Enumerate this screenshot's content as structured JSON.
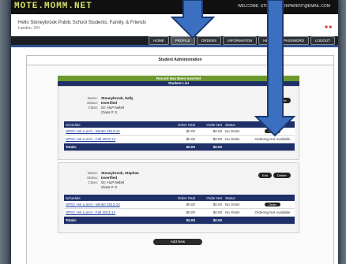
{
  "header": {
    "logo": "MOTE.MOMM.NET",
    "welcome": "WELCOME: STONEBROOKPARENT@EMAIL.COM",
    "greeting": "Hello Stoneybrook Public School Students, Family, & Friends",
    "location": "Landon, OH",
    "flags": "■ ■"
  },
  "nav": {
    "tabs": [
      "HOME",
      "PROFILE",
      "ORDERS",
      "INFORMATION",
      "HELP",
      "PASSWORD",
      "LOGOUT"
    ]
  },
  "panel": {
    "title": "Student Administration"
  },
  "list": {
    "banner": "Record Has Been Inserted",
    "subtitle": "Student List"
  },
  "labels": {
    "name": "Name:",
    "status": "Status:",
    "class": "Class:"
  },
  "students": [
    {
      "name": "Stoneybrook, Sally",
      "status": "Inverified",
      "class_line1": "Gr: HLP Nebel",
      "class_line2": "Class #: 0",
      "button": "Delete",
      "schedules": [
        {
          "name": "SPSC Hot Lunch - Winter 2013-14",
          "total": "$0.00",
          "net": "$0.00",
          "status": "No Order",
          "action": "Order"
        },
        {
          "name": "SPSC Hot Lunch - Fall 2013-14",
          "total": "$0.00",
          "net": "$0.00",
          "status": "No Order",
          "action": "Ordering Not Available"
        }
      ],
      "totals": {
        "label": "Totals:",
        "total": "$0.00",
        "net": "$0.00"
      }
    },
    {
      "name": "Stoneybrook, Stephan",
      "status": "Inverified",
      "class_line1": "Gr: HLP Nebel",
      "class_line2": "Class #: 0",
      "buttons": [
        "Edit",
        "Delete"
      ],
      "schedules": [
        {
          "name": "SPSC Hot Lunch - Winter 2013-14",
          "total": "$0.00",
          "net": "$0.00",
          "status": "No Order",
          "action": "Order"
        },
        {
          "name": "SPSC Hot Lunch - Fall 2013-14",
          "total": "$0.00",
          "net": "$0.00",
          "status": "No Order",
          "action": "Ordering Not Available"
        }
      ],
      "totals": {
        "label": "Totals:",
        "total": "$0.00",
        "net": "$0.00"
      }
    }
  ],
  "columns": {
    "schedule": "Schedule",
    "order_total": "Order Total",
    "order_net": "Order Net",
    "status": "Status"
  },
  "add_new": "Add New",
  "colors": {
    "accent_green": "#6d9a2d",
    "header_blue": "#1f2f68",
    "arrow_blue": "#3b6fc0"
  }
}
